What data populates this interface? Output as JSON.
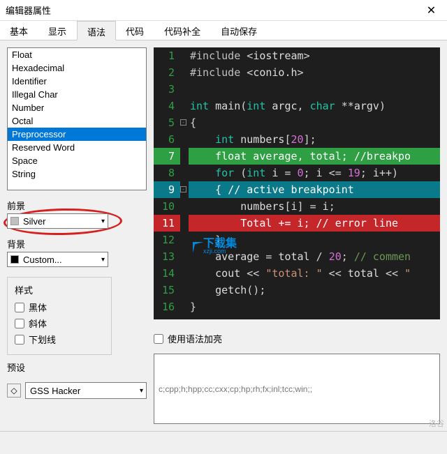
{
  "window": {
    "title": "编辑器属性"
  },
  "tabs": [
    "基本",
    "显示",
    "语法",
    "代码",
    "代码补全",
    "自动保存"
  ],
  "active_tab": 2,
  "token_list": [
    "Float",
    "Hexadecimal",
    "Identifier",
    "Illegal Char",
    "Number",
    "Octal",
    "Preprocessor",
    "Reserved Word",
    "Space",
    "String"
  ],
  "token_selected": "Preprocessor",
  "foreground": {
    "label": "前景",
    "value": "Silver",
    "swatch": "#c0c0c0"
  },
  "background": {
    "label": "背景",
    "value": "Custom...",
    "swatch": "#000000"
  },
  "style": {
    "label": "样式",
    "bold": "黑体",
    "italic": "斜体",
    "underline": "下划线"
  },
  "preset": {
    "label": "预设",
    "value": "GSS Hacker"
  },
  "syntax_highlight": {
    "label": "使用语法加亮",
    "extensions": "c;cpp;h;hpp;cc;cxx;cp;hp;rh;fx;inl;tcc;win;;"
  },
  "watermark": {
    "text": "下载集",
    "sub": "xzji.com"
  },
  "corner": "洛谷",
  "code": {
    "lines": [
      {
        "n": 1,
        "segs": [
          {
            "c": "preproc",
            "t": "#include "
          },
          {
            "c": "op",
            "t": "<"
          },
          {
            "c": "id",
            "t": "iostream"
          },
          {
            "c": "op",
            "t": ">"
          }
        ]
      },
      {
        "n": 2,
        "segs": [
          {
            "c": "preproc",
            "t": "#include "
          },
          {
            "c": "op",
            "t": "<"
          },
          {
            "c": "id",
            "t": "conio.h"
          },
          {
            "c": "op",
            "t": ">"
          }
        ]
      },
      {
        "n": 3,
        "segs": []
      },
      {
        "n": 4,
        "segs": [
          {
            "c": "kw",
            "t": "int"
          },
          {
            "c": "id",
            "t": " main"
          },
          {
            "c": "op",
            "t": "("
          },
          {
            "c": "kw",
            "t": "int"
          },
          {
            "c": "id",
            "t": " argc"
          },
          {
            "c": "op",
            "t": ", "
          },
          {
            "c": "kw",
            "t": "char"
          },
          {
            "c": "op",
            "t": " **"
          },
          {
            "c": "id",
            "t": "argv"
          },
          {
            "c": "op",
            "t": ")"
          }
        ]
      },
      {
        "n": 5,
        "fold": true,
        "segs": [
          {
            "c": "op",
            "t": "{"
          }
        ]
      },
      {
        "n": 6,
        "segs": [
          {
            "c": "op",
            "t": "    "
          },
          {
            "c": "kw",
            "t": "int"
          },
          {
            "c": "id",
            "t": " numbers"
          },
          {
            "c": "op",
            "t": "["
          },
          {
            "c": "num",
            "t": "20"
          },
          {
            "c": "op",
            "t": "];"
          }
        ]
      },
      {
        "n": 7,
        "hl": "hl-green",
        "segs": [
          {
            "c": "op",
            "t": "    "
          },
          {
            "c": "kw",
            "t": "float"
          },
          {
            "c": "id",
            "t": " average"
          },
          {
            "c": "op",
            "t": ", "
          },
          {
            "c": "id",
            "t": "total"
          },
          {
            "c": "op",
            "t": "; "
          },
          {
            "c": "cmt",
            "t": "//breakpo"
          }
        ]
      },
      {
        "n": 8,
        "segs": [
          {
            "c": "op",
            "t": "    "
          },
          {
            "c": "kw",
            "t": "for"
          },
          {
            "c": "op",
            "t": " ("
          },
          {
            "c": "kw",
            "t": "int"
          },
          {
            "c": "id",
            "t": " i "
          },
          {
            "c": "op",
            "t": "= "
          },
          {
            "c": "num",
            "t": "0"
          },
          {
            "c": "op",
            "t": "; "
          },
          {
            "c": "id",
            "t": "i "
          },
          {
            "c": "op",
            "t": "<= "
          },
          {
            "c": "num",
            "t": "19"
          },
          {
            "c": "op",
            "t": "; "
          },
          {
            "c": "id",
            "t": "i"
          },
          {
            "c": "op",
            "t": "++)"
          }
        ]
      },
      {
        "n": 9,
        "fold": true,
        "hl": "hl-teal",
        "segs": [
          {
            "c": "op",
            "t": "    { "
          },
          {
            "c": "cmt",
            "t": "// active breakpoint"
          }
        ]
      },
      {
        "n": 10,
        "segs": [
          {
            "c": "op",
            "t": "        "
          },
          {
            "c": "id",
            "t": "numbers"
          },
          {
            "c": "op",
            "t": "["
          },
          {
            "c": "id",
            "t": "i"
          },
          {
            "c": "op",
            "t": "] = "
          },
          {
            "c": "id",
            "t": "i"
          },
          {
            "c": "op",
            "t": ";"
          }
        ]
      },
      {
        "n": 11,
        "hl": "hl-red",
        "segs": [
          {
            "c": "op",
            "t": "        "
          },
          {
            "c": "id",
            "t": "Total "
          },
          {
            "c": "op",
            "t": "+= "
          },
          {
            "c": "id",
            "t": "i"
          },
          {
            "c": "op",
            "t": "; "
          },
          {
            "c": "cmt",
            "t": "// error line"
          }
        ]
      },
      {
        "n": 12,
        "segs": [
          {
            "c": "op",
            "t": "    }"
          }
        ]
      },
      {
        "n": 13,
        "segs": [
          {
            "c": "op",
            "t": "    "
          },
          {
            "c": "id",
            "t": "average "
          },
          {
            "c": "op",
            "t": "= "
          },
          {
            "c": "id",
            "t": "total "
          },
          {
            "c": "op",
            "t": "/ "
          },
          {
            "c": "num",
            "t": "20"
          },
          {
            "c": "op",
            "t": "; "
          },
          {
            "c": "cmt",
            "t": "// commen"
          }
        ]
      },
      {
        "n": 14,
        "segs": [
          {
            "c": "op",
            "t": "    "
          },
          {
            "c": "id",
            "t": "cout "
          },
          {
            "c": "op",
            "t": "<< "
          },
          {
            "c": "str",
            "t": "\"total: \""
          },
          {
            "c": "op",
            "t": " << "
          },
          {
            "c": "id",
            "t": "total "
          },
          {
            "c": "op",
            "t": "<< "
          },
          {
            "c": "str",
            "t": "\""
          }
        ]
      },
      {
        "n": 15,
        "segs": [
          {
            "c": "op",
            "t": "    "
          },
          {
            "c": "id",
            "t": "getch"
          },
          {
            "c": "op",
            "t": "();"
          }
        ]
      },
      {
        "n": 16,
        "segs": [
          {
            "c": "op",
            "t": "}"
          }
        ]
      }
    ]
  }
}
